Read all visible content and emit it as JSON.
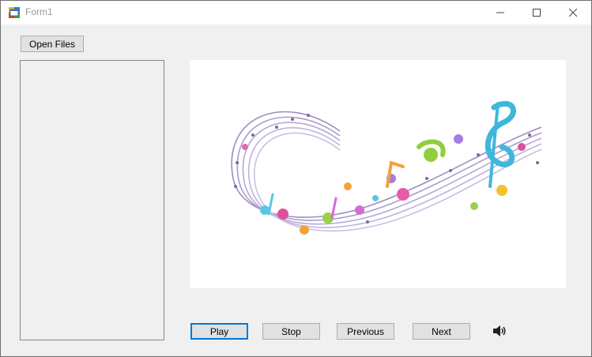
{
  "window": {
    "title": "Form1",
    "icon": "winforms-app-icon",
    "controls": {
      "minimize": "minimize-icon",
      "maximize": "maximize-icon",
      "close": "close-icon"
    }
  },
  "toolbar": {
    "open_files_label": "Open Files"
  },
  "playlist": {
    "items": []
  },
  "artwork": {
    "description_icon": "music-notes-swirl-image"
  },
  "controls": {
    "play_label": "Play",
    "stop_label": "Stop",
    "previous_label": "Previous",
    "next_label": "Next",
    "volume_icon": "speaker-icon"
  },
  "colors": {
    "accent": "#0078d7",
    "button_face": "#e1e1e1",
    "form_back": "#f0f0f0"
  }
}
